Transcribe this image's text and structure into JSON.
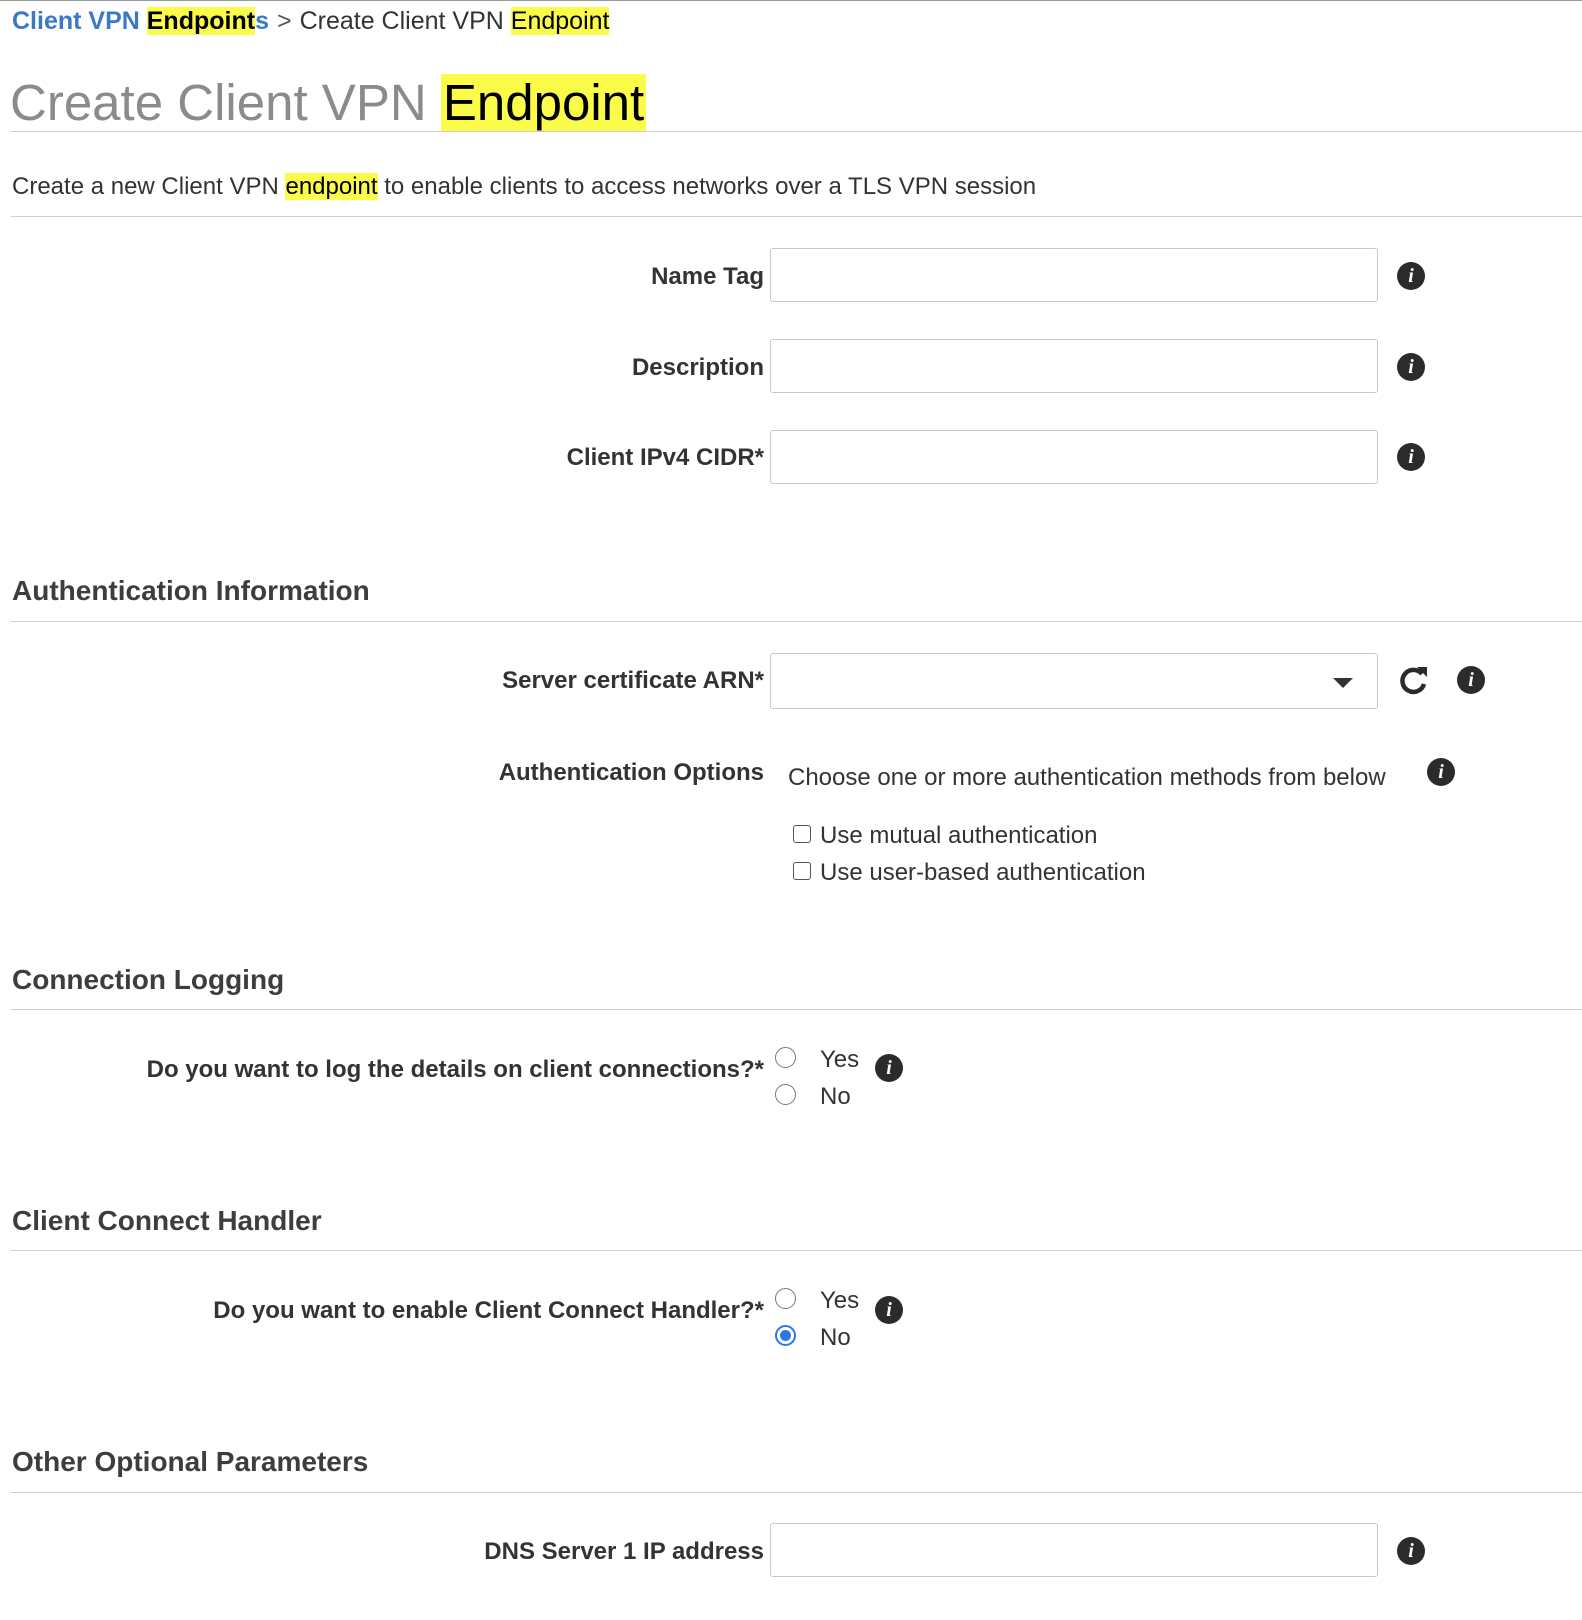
{
  "breadcrumb": {
    "parent_pre": "Client VPN ",
    "parent_hl": "Endpoint",
    "parent_post": "s",
    "separator": ">",
    "current_pre": "Create Client VPN ",
    "current_hl": "Endpoint"
  },
  "page_title": {
    "pre": "Create Client VPN ",
    "hl": "Endpoint"
  },
  "subtitle": {
    "pre": "Create a new Client VPN ",
    "hl": "endpoint",
    "post": " to enable clients to access networks over a TLS VPN session"
  },
  "fields": {
    "name_tag": {
      "label": "Name Tag",
      "value": ""
    },
    "description": {
      "label": "Description",
      "value": ""
    },
    "client_cidr": {
      "label": "Client IPv4 CIDR*",
      "value": ""
    }
  },
  "auth": {
    "heading": "Authentication Information",
    "server_cert_label": "Server certificate ARN*",
    "server_cert_value": "",
    "options_label": "Authentication Options",
    "options_hint": "Choose one or more authentication methods from below",
    "mutual_label": "Use mutual authentication",
    "user_label": "Use user-based authentication"
  },
  "logging": {
    "heading": "Connection Logging",
    "question": "Do you want to log the details on client connections?*",
    "yes": "Yes",
    "no": "No"
  },
  "handler": {
    "heading": "Client Connect Handler",
    "question": "Do you want to enable Client Connect Handler?*",
    "yes": "Yes",
    "no": "No",
    "selected": "No"
  },
  "optional": {
    "heading": "Other Optional Parameters",
    "dns1_label": "DNS Server 1 IP address",
    "dns1_value": ""
  },
  "icons": {
    "info": "info-icon",
    "refresh": "refresh-icon",
    "caret": "chevron-down-icon"
  },
  "colors": {
    "link": "#3a79c8",
    "highlight": "#fbfb4a",
    "radio_selected": "#2b78e4"
  }
}
